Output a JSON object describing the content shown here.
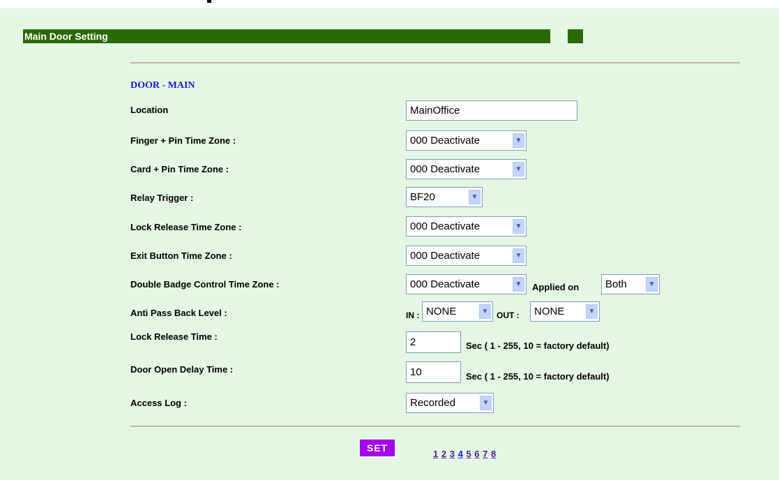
{
  "window": {
    "title": "Main Door Setting"
  },
  "section": {
    "title": "DOOR - MAIN"
  },
  "fields": {
    "location": {
      "label": "Location",
      "value": "MainOffice"
    },
    "finger_pin_tz": {
      "label": "Finger + Pin Time Zone :",
      "value": "000 Deactivate"
    },
    "card_pin_tz": {
      "label": "Card + Pin Time Zone :",
      "value": "000 Deactivate"
    },
    "relay_trigger": {
      "label": "Relay Trigger :",
      "value": "BF20"
    },
    "lock_release_tz": {
      "label": "Lock Release Time Zone :",
      "value": "000 Deactivate"
    },
    "exit_button_tz": {
      "label": "Exit Button Time Zone :",
      "value": "000 Deactivate"
    },
    "double_badge_tz": {
      "label": "Double Badge Control Time Zone :",
      "value": "000 Deactivate",
      "applied_label": "Applied on",
      "applied_value": "Both"
    },
    "anti_pass_back": {
      "label": "Anti Pass Back Level :",
      "in_label": "IN :",
      "in_value": "NONE",
      "out_label": "OUT :",
      "out_value": "NONE"
    },
    "lock_release_time": {
      "label": "Lock Release Time  :",
      "value": "2",
      "hint": "Sec ( 1 - 255, 10 = factory default)"
    },
    "door_open_delay": {
      "label": "Door Open Delay Time  :",
      "value": "10",
      "hint": "Sec ( 1 - 255, 10 = factory default)"
    },
    "access_log": {
      "label": "Access Log :",
      "value": "Recorded"
    }
  },
  "actions": {
    "set_label": "SET"
  },
  "pagination": {
    "pages": [
      "1",
      "2",
      "3",
      "4",
      "5",
      "6",
      "7",
      "8"
    ]
  },
  "colors": {
    "background": "#e4f6e4",
    "titlebar": "#2a6a06",
    "section_title": "#1a1ad6",
    "set_button": "#a400ee"
  }
}
